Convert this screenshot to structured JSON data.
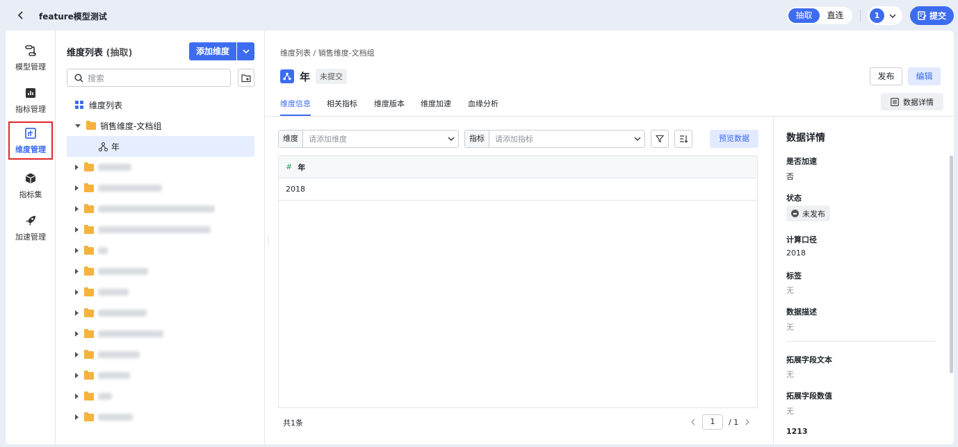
{
  "header": {
    "title": "feature模型测试",
    "mode_options": [
      "抽取",
      "直连"
    ],
    "active_mode": "抽取",
    "user_number": "1",
    "submit_label": "提交"
  },
  "nav": {
    "items": [
      {
        "label": "模型管理",
        "icon": "model-icon"
      },
      {
        "label": "指标管理",
        "icon": "chart-icon"
      },
      {
        "label": "维度管理",
        "icon": "dimension-icon"
      },
      {
        "label": "指标集",
        "icon": "cube-icon"
      },
      {
        "label": "加速管理",
        "icon": "rocket-icon"
      }
    ],
    "active": "维度管理"
  },
  "tree": {
    "title": "维度列表",
    "title_suffix": "(抽取)",
    "add_label": "添加维度",
    "search_placeholder": "搜索",
    "root_label": "维度列表",
    "group_label": "销售维度-文档组",
    "selected_item": "年"
  },
  "main": {
    "breadcrumb": "维度列表 / 销售维度-文档组",
    "dimension_name": "年",
    "status_tag": "未提交",
    "publish_label": "发布",
    "edit_label": "编辑",
    "tabs": [
      "维度信息",
      "相关指标",
      "维度版本",
      "维度加速",
      "血缘分析"
    ],
    "active_tab": "维度信息",
    "detail_button": "数据详情",
    "filter_dimension_label": "维度",
    "filter_dimension_placeholder": "请添加维度",
    "filter_metric_label": "指标",
    "filter_metric_placeholder": "请添加指标",
    "preview_label": "预览数据",
    "table": {
      "column": "年",
      "rows": [
        "2018"
      ]
    },
    "total": "共1条",
    "page_current": "1",
    "page_total": "/ 1"
  },
  "detail": {
    "heading": "数据详情",
    "fields": [
      {
        "label": "是否加速",
        "value": "否"
      },
      {
        "label": "状态",
        "value": "未发布"
      },
      {
        "label": "计算口径",
        "value": "2018"
      },
      {
        "label": "标签",
        "value": "无"
      },
      {
        "label": "数据描述",
        "value": "无"
      },
      {
        "label": "拓展字段文本",
        "value": "无"
      },
      {
        "label": "拓展字段数值",
        "value": "无"
      },
      {
        "label": "1213",
        "value": ""
      }
    ]
  },
  "colors": {
    "accent": "#3d6cf0",
    "selected_bg": "#e5eeff",
    "highlight_border": "#e0262c",
    "folder": "#f5b23e"
  }
}
